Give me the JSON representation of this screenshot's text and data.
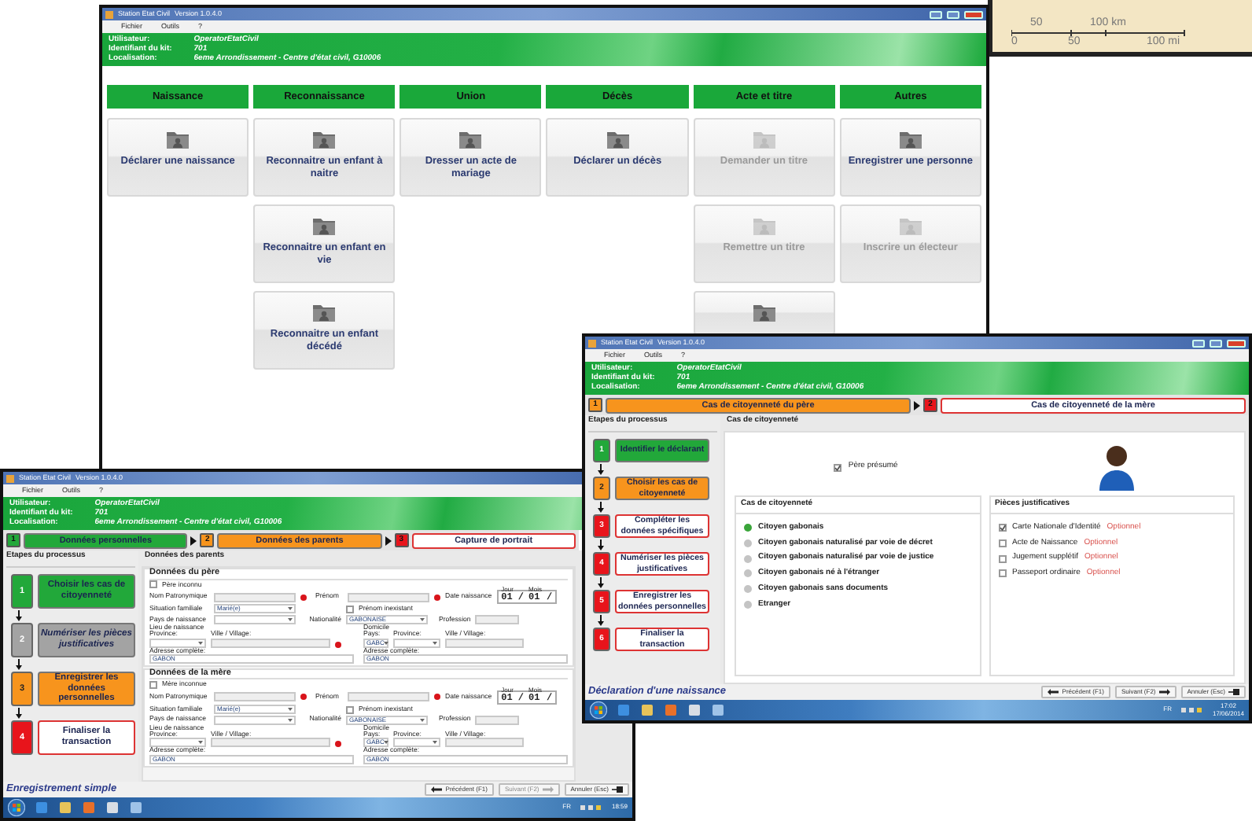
{
  "map_scale": {
    "km_ticks": [
      "50",
      "100 km"
    ],
    "mi_ticks": [
      "0",
      "50",
      "100 mi"
    ]
  },
  "menu_window": {
    "title": "Station Etat Civil",
    "version": "Version 1.0.4.0",
    "menu": [
      "Fichier",
      "Outils",
      "?"
    ],
    "user_info": [
      {
        "label": "Utilisateur:",
        "value": "OperatorEtatCivil"
      },
      {
        "label": "Identifiant du kit:",
        "value": "701"
      },
      {
        "label": "Localisation:",
        "value": "6eme Arrondissement - Centre d'état civil, G10006"
      }
    ],
    "columns": [
      {
        "label": "Naissance",
        "tiles": [
          {
            "label": "Déclarer une naissance",
            "disabled": false
          }
        ]
      },
      {
        "label": "Reconnaissance",
        "tiles": [
          {
            "label": "Reconnaitre un enfant à naitre",
            "disabled": false
          },
          {
            "label": "Reconnaitre un enfant en vie",
            "disabled": false
          },
          {
            "label": "Reconnaitre un enfant décédé",
            "disabled": false
          }
        ]
      },
      {
        "label": "Union",
        "tiles": [
          {
            "label": "Dresser un acte de mariage",
            "disabled": false
          }
        ]
      },
      {
        "label": "Décès",
        "tiles": [
          {
            "label": "Déclarer un décès",
            "disabled": false
          }
        ]
      },
      {
        "label": "Acte et titre",
        "tiles": [
          {
            "label": "Demander un titre",
            "disabled": true
          },
          {
            "label": "Remettre un titre",
            "disabled": true
          },
          {
            "disabled": false
          }
        ]
      },
      {
        "label": "Autres",
        "tiles": [
          {
            "label": "Enregistrer une personne",
            "disabled": false
          },
          {
            "label": "Inscrire un électeur",
            "disabled": true
          }
        ]
      }
    ]
  },
  "citizenship_window": {
    "title": "Station Etat Civil",
    "version": "Version 1.0.4.0",
    "menu": [
      "Fichier",
      "Outils",
      "?"
    ],
    "user_info": [
      {
        "label": "Utilisateur:",
        "value": "OperatorEtatCivil"
      },
      {
        "label": "Identifiant du kit:",
        "value": "701"
      },
      {
        "label": "Localisation:",
        "value": "6eme Arrondissement - Centre d'état civil, G10006"
      }
    ],
    "wizard_steps": [
      {
        "number": "1",
        "label": "Cas de citoyenneté du père",
        "kind": "current"
      },
      {
        "number": "2",
        "label": "Cas de citoyenneté de la mère",
        "kind": "todo"
      }
    ],
    "process_title": "Etapes du processus",
    "process_steps": [
      {
        "number": "1",
        "label": "Identifier le déclarant",
        "kind": "done"
      },
      {
        "number": "2",
        "label": "Choisir les cas de citoyenneté",
        "kind": "current"
      },
      {
        "number": "3",
        "label": "Compléter les données spécifiques",
        "kind": "todo"
      },
      {
        "number": "4",
        "label": "Numériser les pièces justificatives",
        "kind": "todo"
      },
      {
        "number": "5",
        "label": "Enregistrer les données personnelles",
        "kind": "todo"
      },
      {
        "number": "6",
        "label": "Finaliser la transaction",
        "kind": "todo"
      }
    ],
    "section_title": "Cas de citoyenneté",
    "presumed_father": {
      "label": "Père présumé",
      "checked": true
    },
    "cases": {
      "title": "Cas de citoyenneté",
      "options": [
        {
          "label": "Citoyen gabonais",
          "selected": true
        },
        {
          "label": "Citoyen gabonais naturalisé par voie de décret",
          "selected": false
        },
        {
          "label": "Citoyen gabonais naturalisé par voie de justice",
          "selected": false
        },
        {
          "label": "Citoyen gabonais né à l'étranger",
          "selected": false
        },
        {
          "label": "Citoyen gabonais sans documents",
          "selected": false
        },
        {
          "label": "Etranger",
          "selected": false
        }
      ]
    },
    "documents": {
      "title": "Pièces justificatives",
      "items": [
        {
          "label": "Carte Nationale d'Identité",
          "note": "Optionnel",
          "checked": true
        },
        {
          "label": "Acte de Naissance",
          "note": "Optionnel",
          "checked": false
        },
        {
          "label": "Jugement supplétif",
          "note": "Optionnel",
          "checked": false
        },
        {
          "label": "Passeport ordinaire",
          "note": "Optionnel",
          "checked": false
        }
      ]
    },
    "footer_title": "Déclaration d'une naissance",
    "buttons": [
      {
        "label": "Précédent (F1)",
        "kind": "back",
        "disabled": false
      },
      {
        "label": "Suivant (F2)",
        "kind": "next",
        "disabled": false
      },
      {
        "label": "Annuler (Esc)",
        "kind": "cancel",
        "disabled": false
      }
    ],
    "taskbar": {
      "language": "FR",
      "time": "17:02",
      "date": "17/06/2014"
    }
  },
  "parents_window": {
    "title": "Station Etat Civil",
    "version": "Version 1.0.4.0",
    "menu": [
      "Fichier",
      "Outils",
      "?"
    ],
    "user_info": [
      {
        "label": "Utilisateur:",
        "value": "OperatorEtatCivil"
      },
      {
        "label": "Identifiant du kit:",
        "value": "701"
      },
      {
        "label": "Localisation:",
        "value": "6eme Arrondissement - Centre d'état civil, G10006"
      }
    ],
    "wizard_steps": [
      {
        "number": "1",
        "label": "Données personnelles",
        "kind": "done"
      },
      {
        "number": "2",
        "label": "Données des parents",
        "kind": "current"
      },
      {
        "number": "3",
        "label": "Capture de portrait",
        "kind": "todo"
      }
    ],
    "process_title": "Etapes du processus",
    "process_steps": [
      {
        "number": "1",
        "label": "Choisir les cas de citoyenneté",
        "kind": "done"
      },
      {
        "number": "2",
        "label": "Numériser les pièces justificatives",
        "kind": "skipped"
      },
      {
        "number": "3",
        "label": "Enregistrer les données personnelles",
        "kind": "current"
      },
      {
        "number": "4",
        "label": "Finaliser la transaction",
        "kind": "todo"
      }
    ],
    "section_title": "Données des parents",
    "parents": [
      {
        "title": "Données du père",
        "unknown": {
          "label": "Père inconnu",
          "checked": false
        },
        "surname_label": "Nom Patronymique",
        "first_name_label": "Prénom",
        "birth_date_label": "Date naissance",
        "day_label": "Jour",
        "day": "01",
        "month_label": "Mois",
        "month": "01",
        "separators": [
          "/",
          "/"
        ],
        "marital_label": "Situation familiale",
        "marital": "Marié(e)",
        "no_first_name": {
          "label": "Prénom inexistant",
          "checked": false
        },
        "birth_country_label": "Pays de naissance",
        "nationality_label": "Nationalité",
        "nationality": "GABONAISE",
        "profession_label": "Profession",
        "birthplace": {
          "title": "Lieu de naissance",
          "province_label": "Province:",
          "town_label": "Ville / Village:",
          "address_label": "Adresse complète:",
          "address": "GABON"
        },
        "residence": {
          "title": "Domicile",
          "country_label": "Pays:",
          "country": "GABC",
          "province_label": "Province:",
          "town_label": "Ville / Village:",
          "address_label": "Adresse complète:",
          "address": "GABON"
        }
      },
      {
        "title": "Données de la mère",
        "unknown": {
          "label": "Mère inconnue",
          "checked": false
        },
        "surname_label": "Nom Patronymique",
        "first_name_label": "Prénom",
        "birth_date_label": "Date naissance",
        "day_label": "Jour",
        "day": "01",
        "month_label": "Mois",
        "month": "01",
        "separators": [
          "/",
          "/"
        ],
        "marital_label": "Situation familiale",
        "marital": "Marié(e)",
        "no_first_name": {
          "label": "Prénom inexistant",
          "checked": false
        },
        "birth_country_label": "Pays de naissance",
        "nationality_label": "Nationalité",
        "nationality": "GABONAISE",
        "profession_label": "Profession",
        "birthplace": {
          "title": "Lieu de naissance",
          "province_label": "Province:",
          "town_label": "Ville / Village:",
          "address_label": "Adresse complète:",
          "address": "GABON"
        },
        "residence": {
          "title": "Domicile",
          "country_label": "Pays:",
          "country": "GABC",
          "province_label": "Province:",
          "town_label": "Ville / Village:",
          "address_label": "Adresse complète:",
          "address": "GABON"
        }
      }
    ],
    "footer_title": "Enregistrement simple",
    "buttons": [
      {
        "label": "Précédent (F1)",
        "kind": "back",
        "disabled": false
      },
      {
        "label": "Suivant (F2)",
        "kind": "next",
        "disabled": true
      },
      {
        "label": "Annuler (Esc)",
        "kind": "cancel",
        "disabled": false
      }
    ],
    "taskbar": {
      "language": "FR",
      "time": "18:59"
    }
  }
}
